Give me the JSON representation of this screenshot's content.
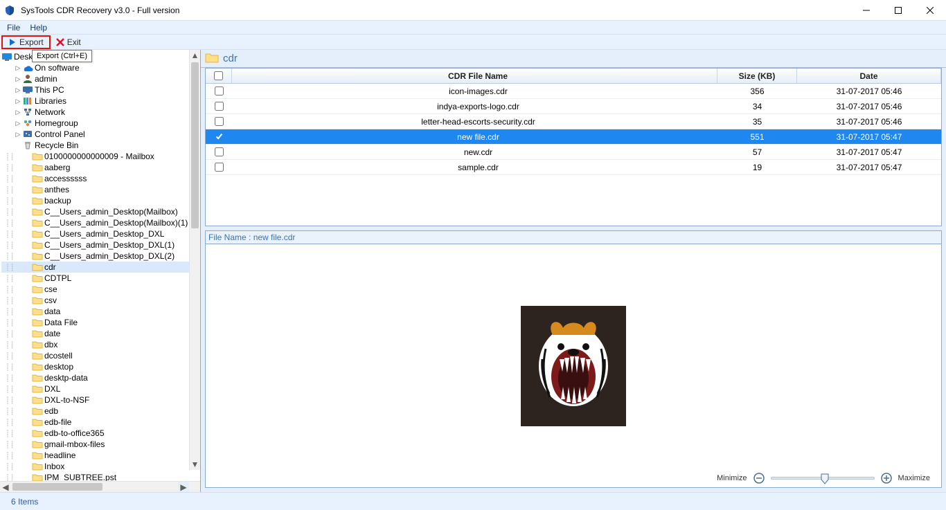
{
  "window": {
    "title": "SysTools CDR Recovery v3.0 - Full version"
  },
  "menubar": {
    "file": "File",
    "help": "Help"
  },
  "toolbar": {
    "export_label": "Export",
    "exit_label": "Exit",
    "tooltip": "Export  (Ctrl+E)"
  },
  "tree": {
    "root": "Desktop",
    "items": [
      {
        "label": "software",
        "icon": "onedrive",
        "twisty": ">",
        "indent": 18,
        "partial": "On"
      },
      {
        "label": "admin",
        "icon": "user",
        "twisty": ">",
        "indent": 18
      },
      {
        "label": "This PC",
        "icon": "pc",
        "twisty": ">",
        "indent": 18
      },
      {
        "label": "Libraries",
        "icon": "libraries",
        "twisty": ">",
        "indent": 18
      },
      {
        "label": "Network",
        "icon": "network",
        "twisty": ">",
        "indent": 18
      },
      {
        "label": "Homegroup",
        "icon": "homegroup",
        "twisty": ">",
        "indent": 18
      },
      {
        "label": "Control Panel",
        "icon": "control",
        "twisty": ">",
        "indent": 18
      },
      {
        "label": "Recycle Bin",
        "icon": "recycle",
        "twisty": "",
        "indent": 18
      },
      {
        "label": "0100000000000009 - Mailbox",
        "icon": "folder",
        "twisty": "",
        "indent": 32
      },
      {
        "label": "aaberg",
        "icon": "folder",
        "twisty": "",
        "indent": 32
      },
      {
        "label": "accessssss",
        "icon": "folder",
        "twisty": "",
        "indent": 32
      },
      {
        "label": "anthes",
        "icon": "folder",
        "twisty": "",
        "indent": 32
      },
      {
        "label": "backup",
        "icon": "folder",
        "twisty": "",
        "indent": 32
      },
      {
        "label": "C__Users_admin_Desktop(Mailbox)",
        "icon": "folder",
        "twisty": "",
        "indent": 32
      },
      {
        "label": "C__Users_admin_Desktop(Mailbox)(1)",
        "icon": "folder",
        "twisty": "",
        "indent": 32
      },
      {
        "label": "C__Users_admin_Desktop_DXL",
        "icon": "folder",
        "twisty": "",
        "indent": 32
      },
      {
        "label": "C__Users_admin_Desktop_DXL(1)",
        "icon": "folder",
        "twisty": "",
        "indent": 32
      },
      {
        "label": "C__Users_admin_Desktop_DXL(2)",
        "icon": "folder",
        "twisty": "",
        "indent": 32
      },
      {
        "label": "cdr",
        "icon": "folder",
        "twisty": "",
        "indent": 32,
        "selected": true
      },
      {
        "label": "CDTPL",
        "icon": "folder",
        "twisty": "",
        "indent": 32
      },
      {
        "label": "cse",
        "icon": "folder",
        "twisty": "",
        "indent": 32
      },
      {
        "label": "csv",
        "icon": "folder",
        "twisty": "",
        "indent": 32
      },
      {
        "label": "data",
        "icon": "folder",
        "twisty": "",
        "indent": 32
      },
      {
        "label": "Data File",
        "icon": "folder",
        "twisty": "",
        "indent": 32
      },
      {
        "label": "date",
        "icon": "folder",
        "twisty": "",
        "indent": 32
      },
      {
        "label": "dbx",
        "icon": "folder",
        "twisty": "",
        "indent": 32
      },
      {
        "label": "dcostell",
        "icon": "folder",
        "twisty": "",
        "indent": 32
      },
      {
        "label": "desktop",
        "icon": "folder",
        "twisty": "",
        "indent": 32
      },
      {
        "label": "desktp-data",
        "icon": "folder",
        "twisty": "",
        "indent": 32
      },
      {
        "label": "DXL",
        "icon": "folder",
        "twisty": "",
        "indent": 32
      },
      {
        "label": "DXL-to-NSF",
        "icon": "folder",
        "twisty": "",
        "indent": 32
      },
      {
        "label": "edb",
        "icon": "folder",
        "twisty": "",
        "indent": 32
      },
      {
        "label": "edb-file",
        "icon": "folder",
        "twisty": "",
        "indent": 32
      },
      {
        "label": "edb-to-office365",
        "icon": "folder",
        "twisty": "",
        "indent": 32
      },
      {
        "label": "gmail-mbox-files",
        "icon": "folder",
        "twisty": "",
        "indent": 32
      },
      {
        "label": "headline",
        "icon": "folder",
        "twisty": "",
        "indent": 32
      },
      {
        "label": "Inbox",
        "icon": "folder",
        "twisty": "",
        "indent": 32
      },
      {
        "label": "IPM_SUBTREE.pst",
        "icon": "folder",
        "twisty": "",
        "indent": 32
      }
    ]
  },
  "path": {
    "folder": "cdr"
  },
  "list": {
    "headers": {
      "name": "CDR File Name",
      "size": "Size (KB)",
      "date": "Date"
    },
    "rows": [
      {
        "name": "icon-images.cdr",
        "size": "356",
        "date": "31-07-2017 05:46",
        "checked": false,
        "selected": false
      },
      {
        "name": "indya-exports-logo.cdr",
        "size": "34",
        "date": "31-07-2017 05:46",
        "checked": false,
        "selected": false
      },
      {
        "name": "letter-head-escorts-security.cdr",
        "size": "35",
        "date": "31-07-2017 05:46",
        "checked": false,
        "selected": false
      },
      {
        "name": "new file.cdr",
        "size": "551",
        "date": "31-07-2017 05:47",
        "checked": true,
        "selected": true
      },
      {
        "name": "new.cdr",
        "size": "57",
        "date": "31-07-2017 05:47",
        "checked": false,
        "selected": false
      },
      {
        "name": "sample.cdr",
        "size": "19",
        "date": "31-07-2017 05:47",
        "checked": false,
        "selected": false
      }
    ]
  },
  "preview": {
    "label_prefix": "File Name : ",
    "file_name": "new file.cdr",
    "minimize": "Minimize",
    "maximize": "Maximize"
  },
  "statusbar": {
    "items": "6 Items"
  }
}
